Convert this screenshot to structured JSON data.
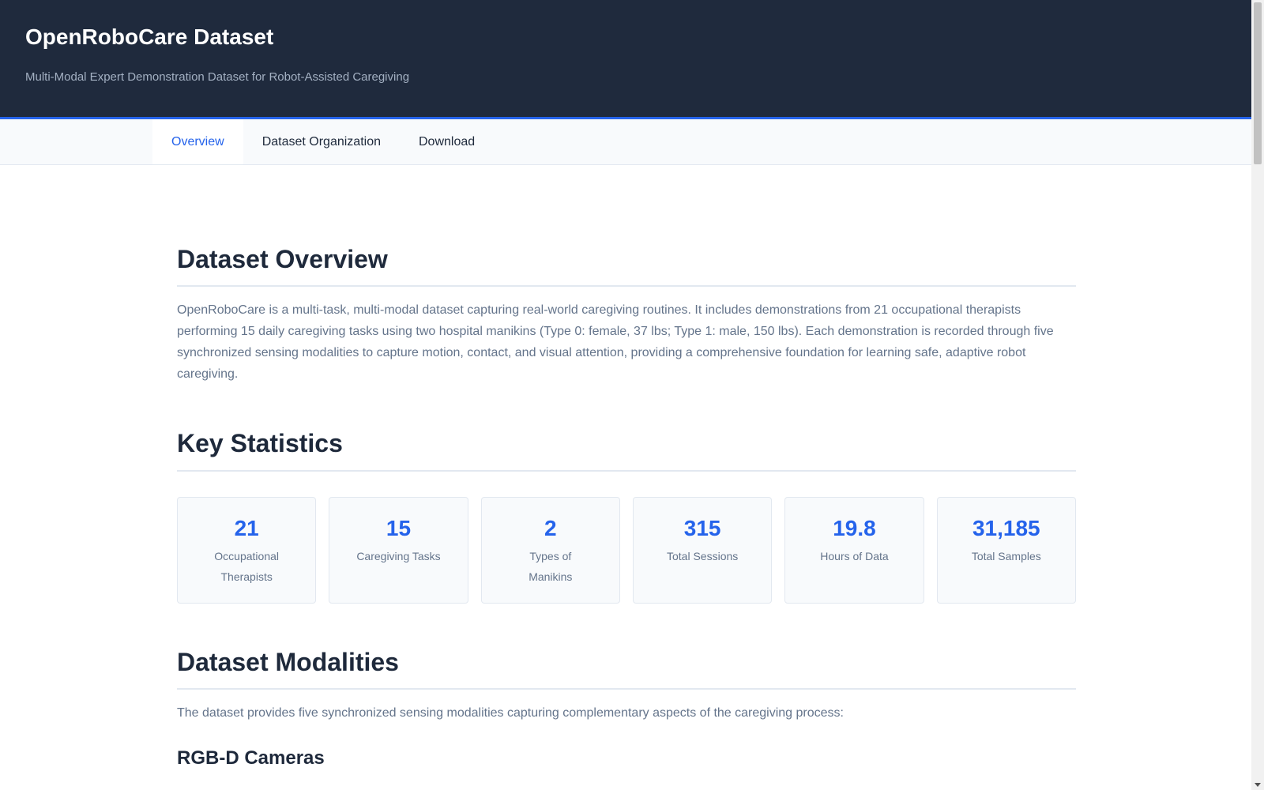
{
  "header": {
    "title": "OpenRoboCare Dataset",
    "subtitle": "Multi-Modal Expert Demonstration Dataset for Robot-Assisted Caregiving"
  },
  "nav": {
    "tabs": [
      {
        "label": "Overview",
        "active": true
      },
      {
        "label": "Dataset Organization",
        "active": false
      },
      {
        "label": "Download",
        "active": false
      }
    ]
  },
  "overview": {
    "heading": "Dataset Overview",
    "text": "OpenRoboCare is a multi-task, multi-modal dataset capturing real-world caregiving routines. It includes demonstrations from 21 occupational therapists performing 15 daily caregiving tasks using two hospital manikins (Type 0: female, 37 lbs; Type 1: male, 150 lbs). Each demonstration is recorded through five synchronized sensing modalities to capture motion, contact, and visual attention, providing a comprehensive foundation for learning safe, adaptive robot caregiving."
  },
  "statistics": {
    "heading": "Key Statistics",
    "cards": [
      {
        "value": "21",
        "label": "Occupational Therapists"
      },
      {
        "value": "15",
        "label": "Caregiving Tasks"
      },
      {
        "value": "2",
        "label": "Types of Manikins"
      },
      {
        "value": "315",
        "label": "Total Sessions"
      },
      {
        "value": "19.8",
        "label": "Hours of Data"
      },
      {
        "value": "31,185",
        "label": "Total Samples"
      }
    ]
  },
  "modalities": {
    "heading": "Dataset Modalities",
    "text": "The dataset provides five synchronized sensing modalities capturing complementary aspects of the caregiving process:",
    "first_subheading": "RGB-D Cameras"
  },
  "colors": {
    "header_bg": "#1f2a3d",
    "accent": "#2563eb",
    "text_muted": "#64748b"
  }
}
